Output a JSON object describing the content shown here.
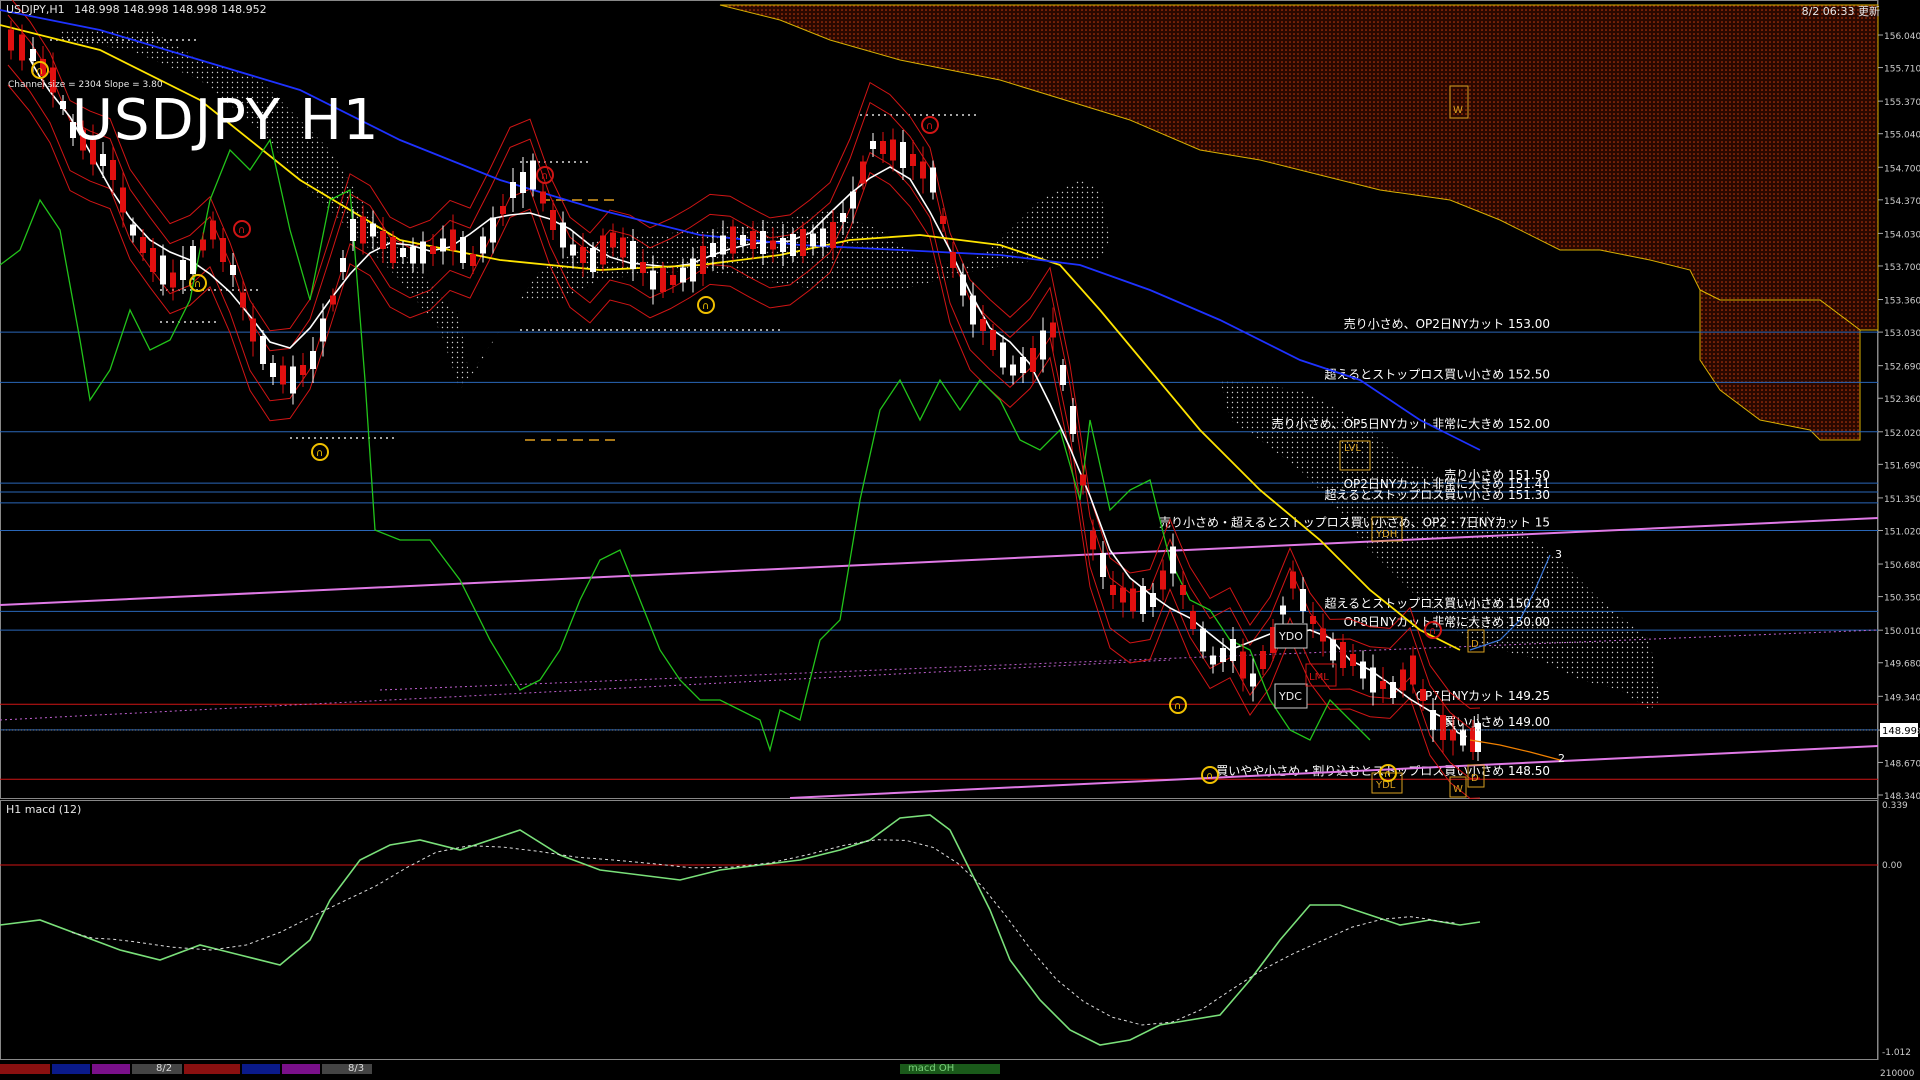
{
  "header": {
    "symbol_info": "USDJPY,H1",
    "ohlc": "148.998 148.998 148.998 148.952",
    "datetime": "8/2 06:33 更新"
  },
  "title": "USDJPY H1",
  "indicator_note": "Channel size = 2304 Slope = 3.80",
  "macd_label": "H1 macd (12)",
  "bottom": {
    "left_date": "8/2",
    "right_date": "8/3",
    "macd_tab": "macd OH"
  },
  "colors": {
    "bull": "#ffffff",
    "bear": "#e01010",
    "kijun": "#ffe400",
    "ma_blue": "#1e32ff",
    "chikou": "#22c41a",
    "bollinger": "#d01515",
    "level_line": "#2a67b8",
    "red_line": "#d01515",
    "trend_pink": "#e07ae6",
    "kumo": "#c23c10"
  },
  "chart_data": {
    "type": "candlestick",
    "title": "USDJPY H1",
    "price_axis": [
      "156.040",
      "155.710",
      "155.370",
      "155.040",
      "154.700",
      "154.370",
      "154.030",
      "153.700",
      "153.360",
      "153.030",
      "152.690",
      "152.360",
      "152.020",
      "151.690",
      "151.350",
      "151.020",
      "150.680",
      "150.350",
      "150.010",
      "149.680",
      "149.340",
      "148.998",
      "148.670",
      "148.340"
    ],
    "ylim": [
      148.3,
      156.3
    ],
    "current_price": 148.998,
    "levels": [
      {
        "price": 153.03,
        "label": "売り小さめ、OP2日NYカット 153.00",
        "color": "blue"
      },
      {
        "price": 152.52,
        "label": "超えるとストップロス買い小さめ 152.50",
        "color": "blue"
      },
      {
        "price": 152.02,
        "label": "売り小さめ、OP5日NYカット非常に大きめ 152.00",
        "color": "blue"
      },
      {
        "price": 151.5,
        "label": "売り小さめ 151.50",
        "color": "blue"
      },
      {
        "price": 151.41,
        "label": "OP2日NYカット非常に大きめ 151.41",
        "color": "blue"
      },
      {
        "price": 151.3,
        "label": "超えるとストップロス買い小さめ 151.30",
        "color": "blue"
      },
      {
        "price": 151.02,
        "label": "売り小さめ・超えるとストップロス買い小さめ、OP2・7日NYカット 15",
        "color": "blue"
      },
      {
        "price": 150.2,
        "label": "超えるとストップロス買い小さめ 150.20",
        "color": "blue"
      },
      {
        "price": 150.01,
        "label": "OP8日NYカット非常に大きめ 150.00",
        "color": "blue"
      },
      {
        "price": 149.26,
        "label": "OP7日NYカット 149.25",
        "color": "red"
      },
      {
        "price": 149.0,
        "label": "買い小さめ 149.00",
        "color": "blue"
      },
      {
        "price": 148.5,
        "label": "買いやや小さめ・割り込むとストップロス買い小さめ 148.50",
        "color": "red"
      }
    ],
    "markers": [
      "YDO",
      "YDC",
      "LML",
      "LVL",
      "YDH",
      "YDL",
      "W",
      "D"
    ],
    "macd_axis": [
      "0.339",
      "0.00",
      "-1.012"
    ],
    "macd_ylim": [
      -1.012,
      0.339
    ]
  }
}
